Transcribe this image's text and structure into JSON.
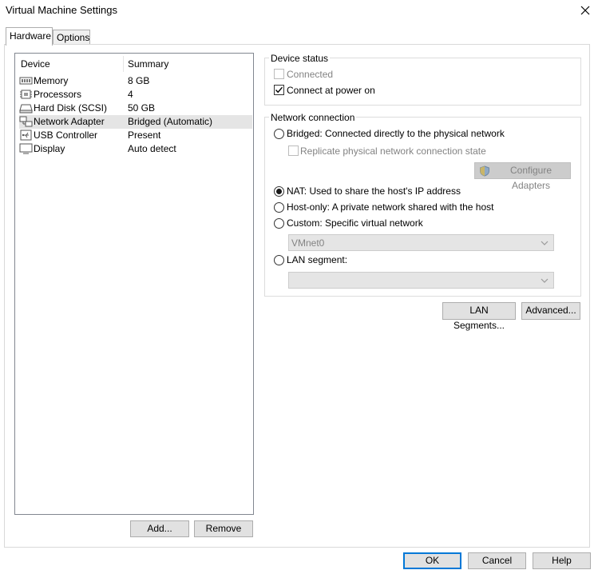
{
  "window": {
    "title": "Virtual Machine Settings"
  },
  "tabs": [
    {
      "label": "Hardware",
      "active": true
    },
    {
      "label": "Options",
      "active": false
    }
  ],
  "device_list": {
    "columns": [
      "Device",
      "Summary"
    ],
    "rows": [
      {
        "icon": "memory-icon",
        "device": "Memory",
        "summary": "8 GB",
        "selected": false
      },
      {
        "icon": "processor-icon",
        "device": "Processors",
        "summary": "4",
        "selected": false
      },
      {
        "icon": "hard-disk-icon",
        "device": "Hard Disk (SCSI)",
        "summary": "50 GB",
        "selected": false
      },
      {
        "icon": "network-adapter-icon",
        "device": "Network Adapter",
        "summary": "Bridged (Automatic)",
        "selected": true
      },
      {
        "icon": "usb-controller-icon",
        "device": "USB Controller",
        "summary": "Present",
        "selected": false
      },
      {
        "icon": "display-icon",
        "device": "Display",
        "summary": "Auto detect",
        "selected": false
      }
    ],
    "add_label": "Add...",
    "remove_label": "Remove"
  },
  "device_status": {
    "title": "Device status",
    "connected": {
      "label": "Connected",
      "checked": false,
      "enabled": false
    },
    "connect_at_power_on": {
      "label": "Connect at power on",
      "checked": true,
      "enabled": true
    }
  },
  "network_connection": {
    "title": "Network connection",
    "bridged": {
      "label": "Bridged: Connected directly to the physical network",
      "selected": false
    },
    "replicate": {
      "label": "Replicate physical network connection state",
      "checked": false,
      "enabled": false
    },
    "configure_adapters_label": "Configure Adapters",
    "nat": {
      "label": "NAT: Used to share the host's IP address",
      "selected": true
    },
    "host_only": {
      "label": "Host-only: A private network shared with the host",
      "selected": false
    },
    "custom": {
      "label": "Custom: Specific virtual network",
      "selected": false
    },
    "custom_network_value": "VMnet0",
    "lan_segment": {
      "label": "LAN segment:",
      "selected": false
    },
    "lan_segment_value": ""
  },
  "network_buttons": {
    "lan_segments_label": "LAN Segments...",
    "advanced_label": "Advanced..."
  },
  "footer": {
    "ok_label": "OK",
    "cancel_label": "Cancel",
    "help_label": "Help"
  },
  "colors": {
    "accent": "#0078d7",
    "selection": "#e5e5e5",
    "disabled_text": "#838383",
    "button_face": "#e1e1e1"
  }
}
